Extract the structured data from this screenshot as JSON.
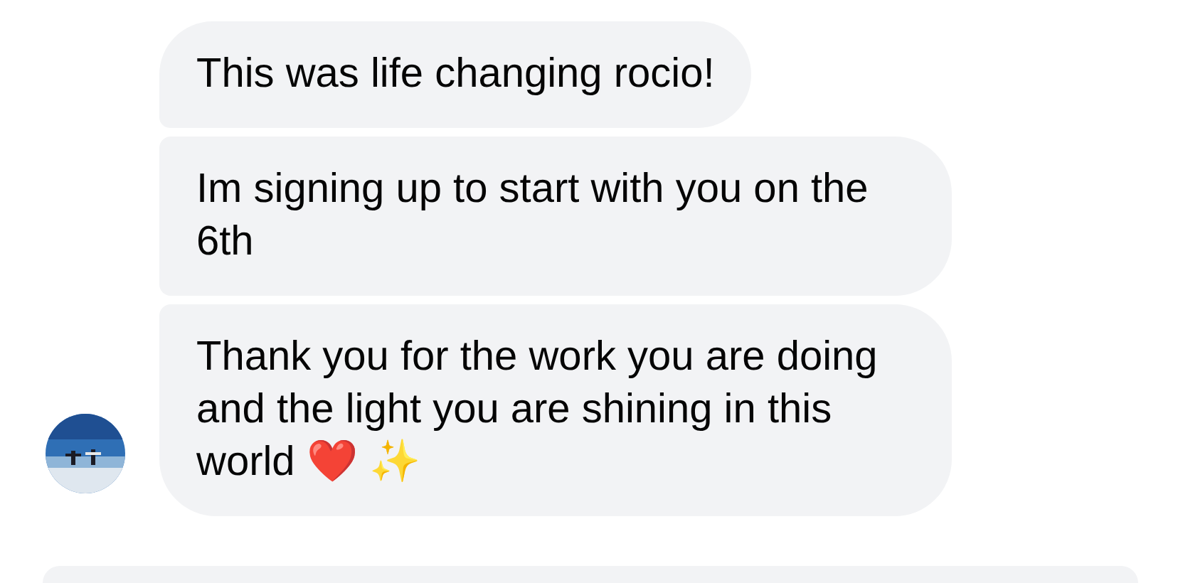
{
  "messages": [
    {
      "text": "This was life changing rocio!",
      "grouped_above": false,
      "grouped_below": true
    },
    {
      "text": "Im signing up to start with you on the 6th",
      "grouped_above": true,
      "grouped_below": true
    },
    {
      "text": "Thank you for the work you are doing and the light you are shining in this world ❤️ ✨",
      "grouped_above": true,
      "grouped_below": false
    }
  ],
  "next_message": {
    "kind": "reply"
  }
}
